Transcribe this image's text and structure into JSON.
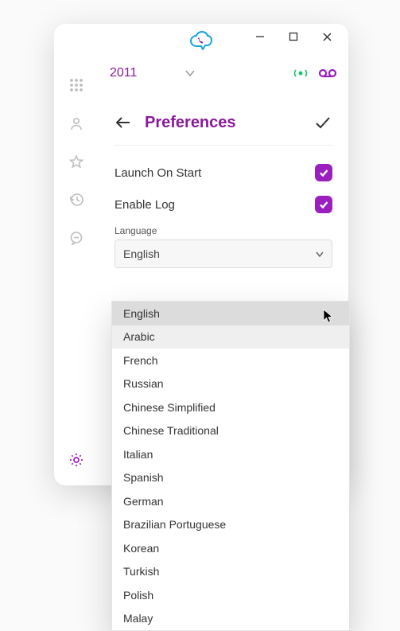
{
  "header": {
    "extension": "2011"
  },
  "preferences": {
    "title": "Preferences",
    "launch_on_start": "Launch On Start",
    "enable_log": "Enable Log",
    "language_label": "Language",
    "language_selected": "English",
    "language_options": [
      "English",
      "Arabic",
      "French",
      "Russian",
      "Chinese Simplified",
      "Chinese Traditional",
      "Italian",
      "Spanish",
      "German",
      "Brazilian Portuguese",
      "Korean",
      "Turkish",
      "Polish",
      "Malay"
    ],
    "hover_index": 1,
    "selected_index": 0
  }
}
